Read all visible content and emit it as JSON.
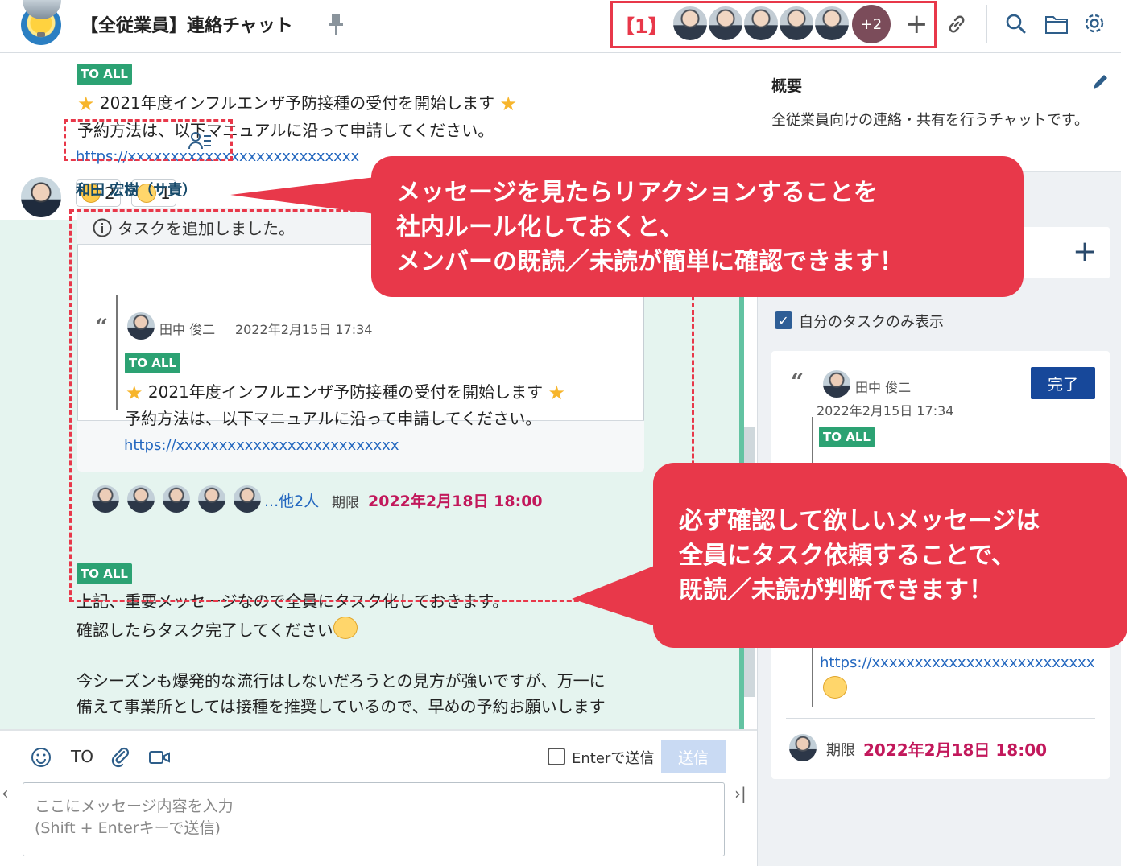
{
  "header": {
    "room_title": "【全従業員】連絡チャット",
    "member_label": "【1】",
    "more_members": "+2",
    "add_member": "+"
  },
  "message1": {
    "badge": "TO ALL",
    "line1": "2021年度インフルエンザ予防接種の受付を開始します",
    "line2": "予約方法は、以下マニュアルに沿って申請してください。",
    "link": "https://xxxxxxxxxxxxxxxxxxxxxxxxxxx",
    "reactions": [
      {
        "emoji": "smile-face",
        "count": "2"
      },
      {
        "emoji": "sweat-face",
        "count": "1"
      }
    ]
  },
  "message2": {
    "sender": "和田 宏樹（サ責）",
    "task_header": "タスクを追加しました。",
    "quote_author": "田中 俊二",
    "quote_time": "2022年2月15日 17:34",
    "quote_badge": "TO ALL",
    "quote_line1": "2021年度インフルエンザ予防接種の受付を開始します",
    "quote_line2": "予約方法は、以下マニュアルに沿って申請してください。",
    "quote_link": "https://xxxxxxxxxxxxxxxxxxxxxxxxxx",
    "assignees_more": "...他2人",
    "due_label": "期限",
    "due_date": "2022年2月18日 18:00",
    "badge": "TO ALL",
    "body_line1": "上記、重要メッセージなので全員にタスク化しておきます。",
    "body_line2": "確認したらタスク完了してください",
    "note_line1": "今シーズンも爆発的な流行はしないだろうとの見方が強いですが、万一に",
    "note_line2": "備えて事業所としては接種を推奨しているので、早めの予約お願いします"
  },
  "composer": {
    "to_label": "TO",
    "enter_label": "Enterで送信",
    "send_label": "送信",
    "placeholder": "ここにメッセージ内容を入力\n(Shift + Enterキーで送信)"
  },
  "sidebar": {
    "overview_title": "概要",
    "overview_desc": "全従業員向けの連絡・共有を行うチャットです。",
    "add_task": "+",
    "mine_only_label": "自分のタスクのみ表示",
    "card": {
      "author": "田中 俊二",
      "time": "2022年2月15日 17:34",
      "done_label": "完了",
      "badge": "TO ALL",
      "link": "https://xxxxxxxxxxxxxxxxxxxxxxxxxx",
      "due_label": "期限",
      "due_date": "2022年2月18日 18:00"
    }
  },
  "callouts": {
    "reaction_tip_line1": "メッセージを見たらリアクションすることを",
    "reaction_tip_line2": "社内ルール化しておくと、",
    "reaction_tip_line3": "メンバーの既読／未読が簡単に確認できます！",
    "task_tip_line1": "必ず確認して欲しいメッセージは",
    "task_tip_line2": "全員にタスク依頼することで、",
    "task_tip_line3": "既読／未読が判断できます！"
  },
  "colors": {
    "accent_red": "#e8384a",
    "badge_green": "#2ca273",
    "link_blue": "#2367bf",
    "due_magenta": "#c2185b",
    "done_button": "#17489a"
  }
}
